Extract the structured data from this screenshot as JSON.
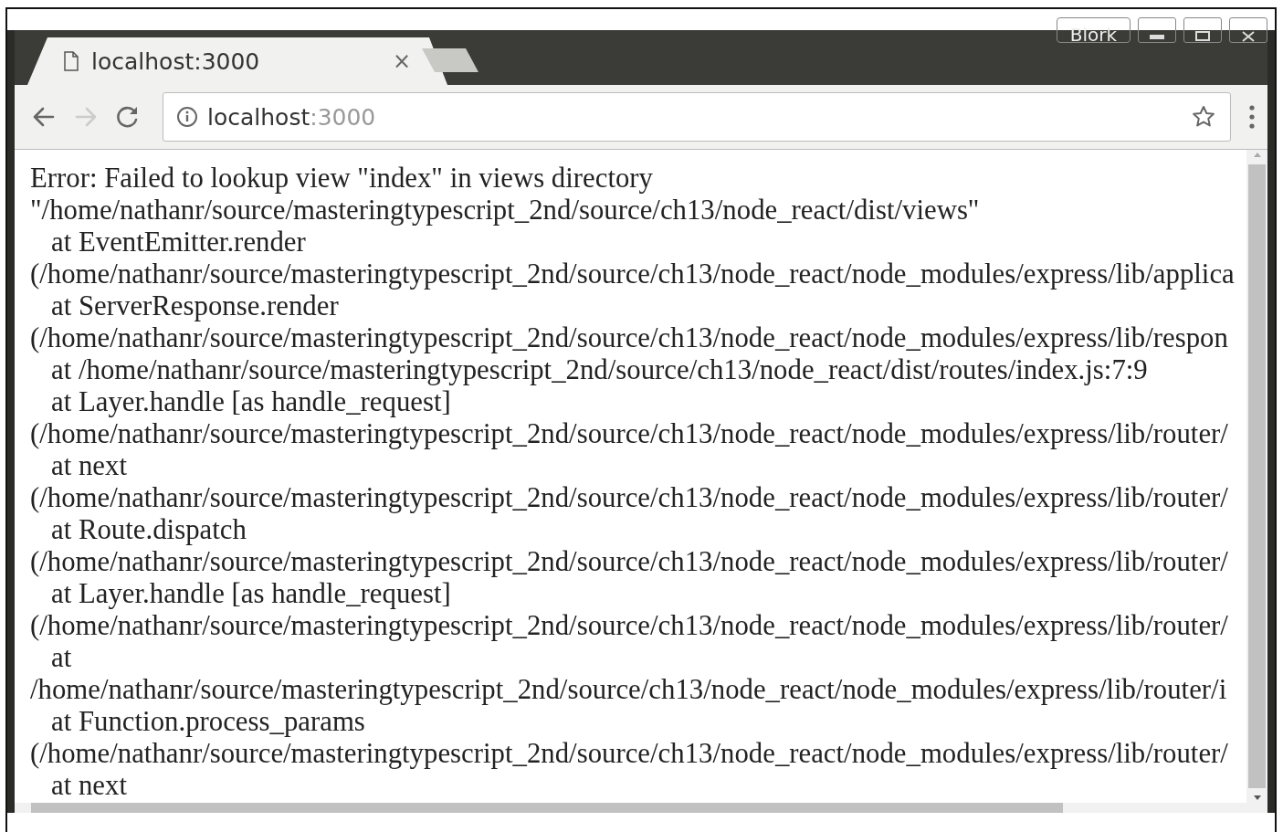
{
  "window": {
    "profile_button": "Blork"
  },
  "tabs": [
    {
      "title": "localhost:3000",
      "selected": true,
      "close": "×"
    }
  ],
  "address_bar": {
    "host": "localhost",
    "port": ":3000"
  },
  "page": {
    "lines": [
      {
        "kind": "text",
        "text": "Error: Failed to lookup view \"index\" in views directory"
      },
      {
        "kind": "text",
        "text": "\"/home/nathanr/source/masteringtypescript_2nd/source/ch13/node_react/dist/views\""
      },
      {
        "kind": "frame",
        "text": "at EventEmitter.render"
      },
      {
        "kind": "text",
        "text": "(/home/nathanr/source/masteringtypescript_2nd/source/ch13/node_react/node_modules/express/lib/applica"
      },
      {
        "kind": "frame",
        "text": "at ServerResponse.render"
      },
      {
        "kind": "text",
        "text": "(/home/nathanr/source/masteringtypescript_2nd/source/ch13/node_react/node_modules/express/lib/respon"
      },
      {
        "kind": "frame",
        "text": "at /home/nathanr/source/masteringtypescript_2nd/source/ch13/node_react/dist/routes/index.js:7:9"
      },
      {
        "kind": "frame",
        "text": "at Layer.handle [as handle_request]"
      },
      {
        "kind": "text",
        "text": "(/home/nathanr/source/masteringtypescript_2nd/source/ch13/node_react/node_modules/express/lib/router/"
      },
      {
        "kind": "frame",
        "text": "at next"
      },
      {
        "kind": "text",
        "text": "(/home/nathanr/source/masteringtypescript_2nd/source/ch13/node_react/node_modules/express/lib/router/"
      },
      {
        "kind": "frame",
        "text": "at Route.dispatch"
      },
      {
        "kind": "text",
        "text": "(/home/nathanr/source/masteringtypescript_2nd/source/ch13/node_react/node_modules/express/lib/router/"
      },
      {
        "kind": "frame",
        "text": "at Layer.handle [as handle_request]"
      },
      {
        "kind": "text",
        "text": "(/home/nathanr/source/masteringtypescript_2nd/source/ch13/node_react/node_modules/express/lib/router/"
      },
      {
        "kind": "frame",
        "text": "at"
      },
      {
        "kind": "text",
        "text": "/home/nathanr/source/masteringtypescript_2nd/source/ch13/node_react/node_modules/express/lib/router/i"
      },
      {
        "kind": "frame",
        "text": "at Function.process_params"
      },
      {
        "kind": "text",
        "text": "(/home/nathanr/source/masteringtypescript_2nd/source/ch13/node_react/node_modules/express/lib/router/"
      },
      {
        "kind": "frame",
        "text": "at next"
      }
    ]
  }
}
